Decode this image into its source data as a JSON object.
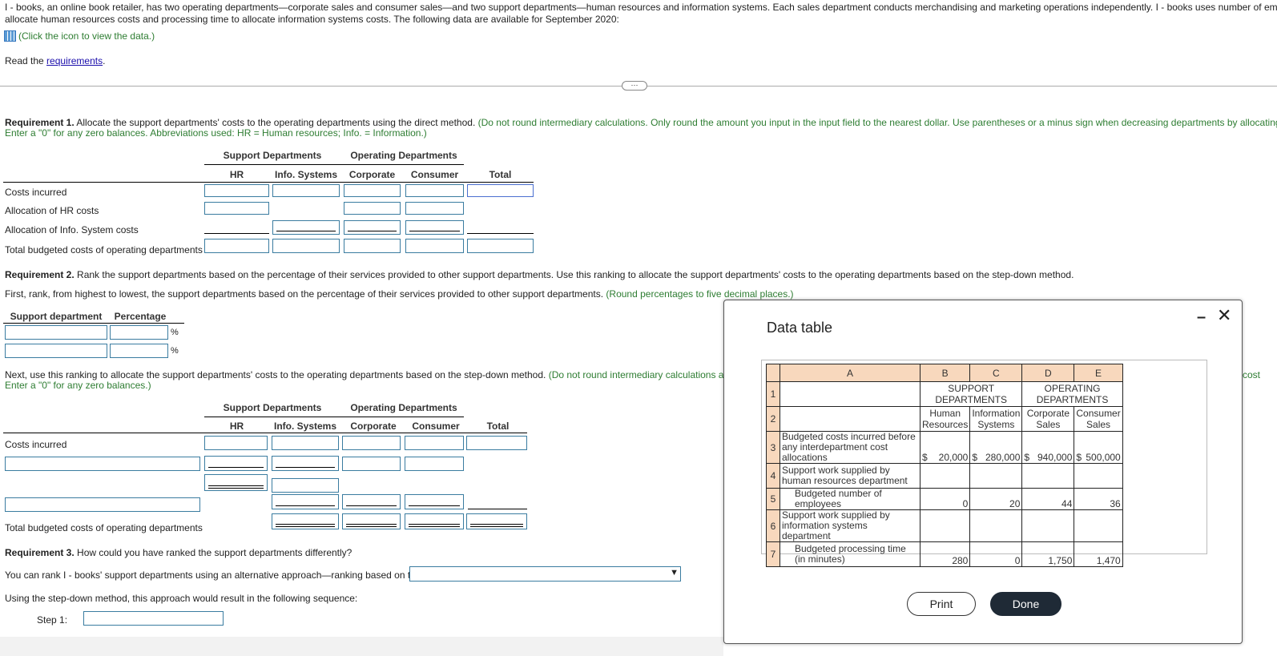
{
  "intro": {
    "line1": "I - books, an online book retailer, has two operating departments—corporate sales and consumer sales—and two support departments—human resources and information systems. Each sales department conducts merchandising and marketing operations independently. I - books uses number of employees to",
    "line2": "allocate human resources costs and processing time to allocate information systems costs. The following data are available for September 2020:",
    "data_link": "(Click the icon to view the data.)",
    "read": "Read the ",
    "requirements_link": "requirements",
    "read_end": "."
  },
  "req1": {
    "label": "Requirement 1.",
    "text": " Allocate the support departments' costs to the operating departments using the direct method.",
    "hint1": " (Do not round intermediary calculations. Only round the amount you input in the input field to the nearest dollar. Use parentheses or a minus sign when decreasing departments by allocating costs.",
    "hint2": "Enter a \"0\" for any zero balances. Abbreviations used: HR = Human resources; Info. = Information.)",
    "rows": [
      "Costs incurred",
      "Allocation of HR costs",
      "Allocation of Info. System costs",
      "Total budgeted costs of operating departments"
    ]
  },
  "headers": {
    "support": "Support Departments",
    "operating": "Operating Departments",
    "hr": "HR",
    "info": "Info. Systems",
    "corporate": "Corporate",
    "consumer": "Consumer",
    "total": "Total"
  },
  "req2": {
    "label": "Requirement 2.",
    "text": " Rank the support departments based on the percentage of their services provided to other support departments. Use this ranking to allocate the support departments' costs to the operating departments based on the step-down method.",
    "first": "First, rank, from highest to lowest, the support departments based on the percentage of their services provided to other support departments.",
    "first_hint": " (Round percentages to five decimal places.)",
    "col_dept": "Support department",
    "col_pct": "Percentage",
    "pct": "%",
    "next": "Next, use this ranking to allocate the support departments' costs to the operating departments based on the step-down method.",
    "next_hint": " (Do not round intermediary calculations and round",
    "next_hint_tail": "cost",
    "next_hint2": "Enter a \"0\" for any zero balances.)",
    "rows": [
      "Costs incurred",
      "Total budgeted costs of operating departments"
    ]
  },
  "req3": {
    "label": "Requirement 3.",
    "text": " How could you have ranked the support departments differently?",
    "alt": "You can rank I - books' support departments using an alternative approach—ranking based on the",
    "seq": "Using the step-down method, this approach would result in the following sequence:",
    "step1": "Step 1:"
  },
  "modal": {
    "title": "Data table",
    "print": "Print",
    "done": "Done",
    "cols": [
      "",
      "A",
      "B",
      "C",
      "D",
      "E"
    ],
    "support": "SUPPORT DEPARTMENTS",
    "operating": "OPERATING DEPARTMENTS",
    "sub": [
      "Human Resources",
      "Information Systems",
      "Corporate Sales",
      "Consumer Sales"
    ],
    "rows": [
      {
        "n": "3",
        "label": "Budgeted costs incurred before any interdepartment cost allocations",
        "cur": "$",
        "vals": [
          "20,000",
          "280,000",
          "940,000",
          "500,000"
        ]
      },
      {
        "n": "4",
        "label": "Support work supplied by human resources department",
        "vals": [
          "",
          "",
          "",
          ""
        ]
      },
      {
        "n": "5",
        "label": "Budgeted number of employees",
        "vals": [
          "0",
          "20",
          "44",
          "36"
        ]
      },
      {
        "n": "6",
        "label": "Support work supplied by information systems department",
        "vals": [
          "",
          "",
          "",
          ""
        ]
      },
      {
        "n": "7",
        "label": "Budgeted processing time (in minutes)",
        "vals": [
          "280",
          "0",
          "1,750",
          "1,470"
        ]
      }
    ]
  },
  "colors": {
    "accent": "#1a0dab",
    "hint": "#2e7d32",
    "header_fill": "#f8d8bd",
    "input_border": "#3a7ca0"
  }
}
